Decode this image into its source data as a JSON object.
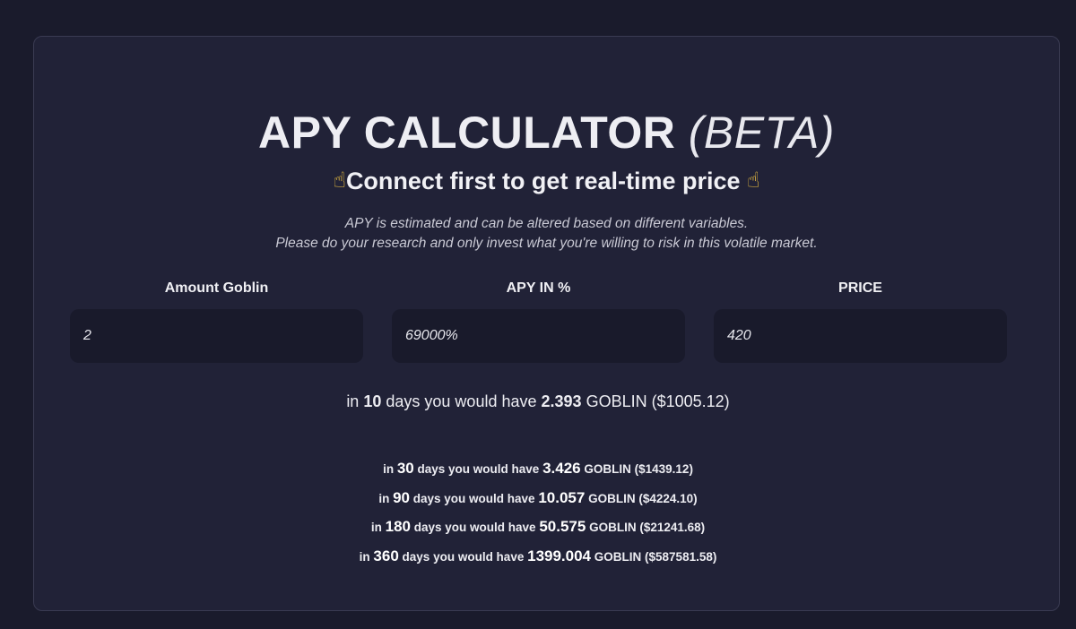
{
  "header": {
    "title": "APY CALCULATOR",
    "title_suffix": "(BETA)",
    "connect_text": "Connect first to get real-time price",
    "hand_icon": "☝",
    "disclaimer_line1": "APY is estimated and can be altered based on different variables.",
    "disclaimer_line2": "Please do your research and only invest what you're willing to risk in this volatile market."
  },
  "fields": [
    {
      "label": "Amount Goblin",
      "value": "2"
    },
    {
      "label": "APY IN %",
      "value": "69000%"
    },
    {
      "label": "PRICE",
      "value": "420"
    }
  ],
  "main_result": {
    "prefix": "in",
    "days": "10",
    "middle": "days you would have",
    "amount": "2.393",
    "suffix": "GOBLIN ($1005.12)"
  },
  "results": [
    {
      "prefix": "in",
      "days": "30",
      "middle": "days you would have",
      "amount": "3.426",
      "suffix": "GOBLIN ($1439.12)"
    },
    {
      "prefix": "in",
      "days": "90",
      "middle": "days you would have",
      "amount": "10.057",
      "suffix": "GOBLIN ($4224.10)"
    },
    {
      "prefix": "in",
      "days": "180",
      "middle": "days you would have",
      "amount": "50.575",
      "suffix": "GOBLIN ($21241.68)"
    },
    {
      "prefix": "in",
      "days": "360",
      "middle": "days you would have",
      "amount": "1399.004",
      "suffix": "GOBLIN ($587581.58)"
    }
  ],
  "colors": {
    "background": "#1a1b2c",
    "card": "#212237",
    "input": "#191a2b",
    "emoji": "#f2c440"
  }
}
